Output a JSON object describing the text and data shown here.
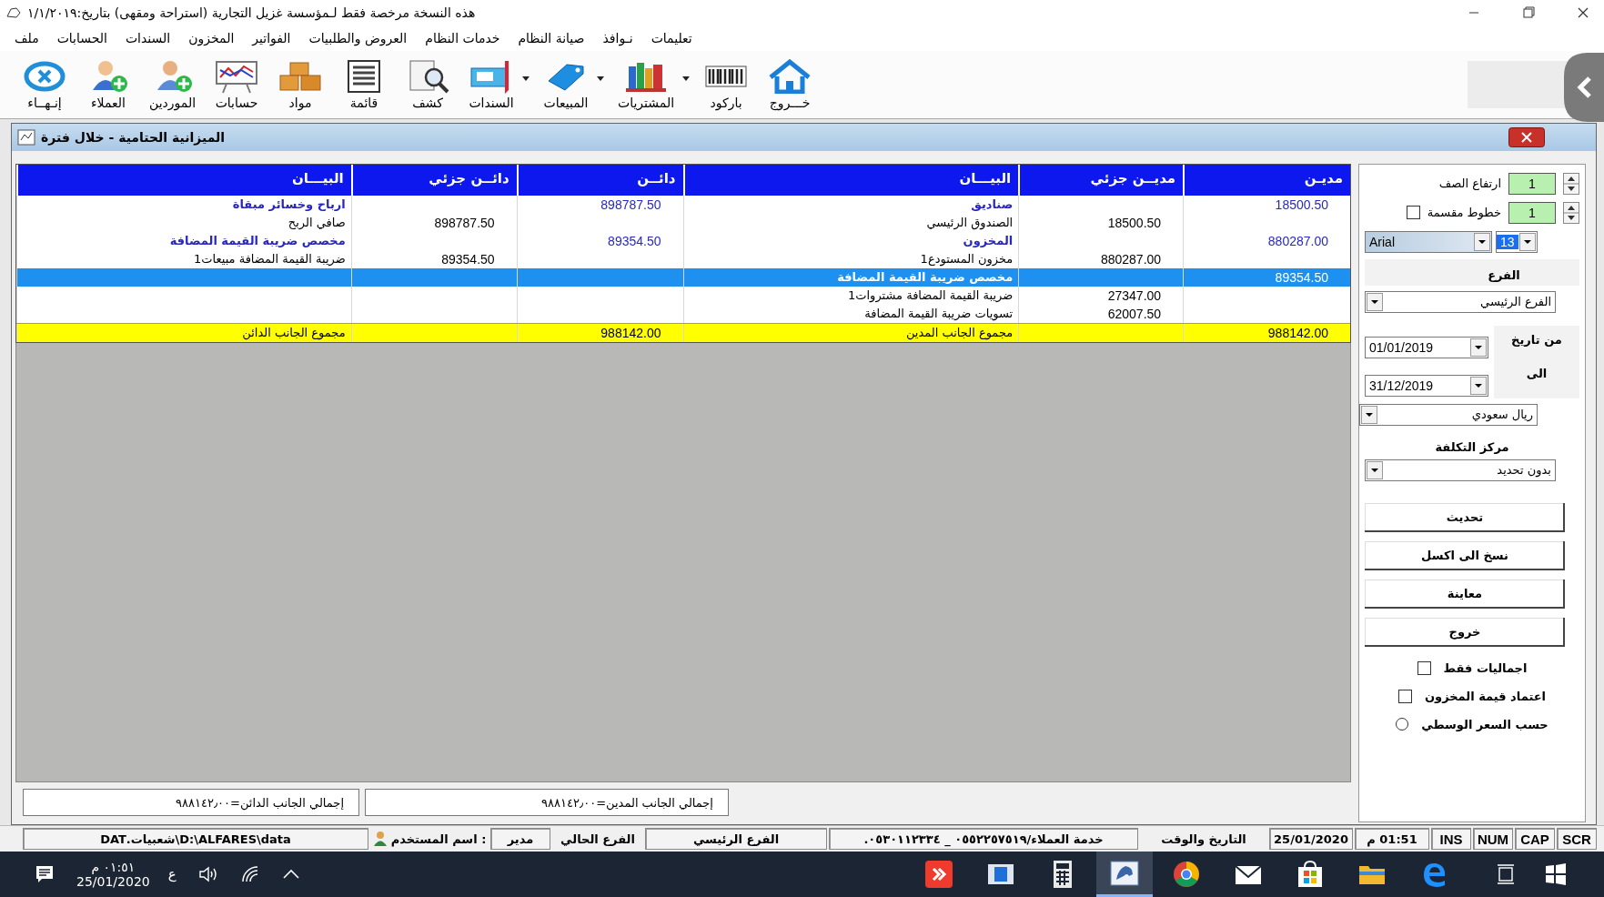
{
  "window": {
    "title": "هذه النسخة مرخصة فقط لـمؤسسة غزيل التجارية (استراحة ومقهى)  بتاريخ:١/١/٢٠١٩"
  },
  "menu": [
    "تعليمات",
    "نـوافذ",
    "صيانة النظام",
    "خدمات النظام",
    "العروض والطلبيات",
    "الفواتير",
    "المخزون",
    "السندات",
    "الحسابات",
    "ملف"
  ],
  "toolbar": [
    {
      "label": "خـــروج",
      "has_menu": false
    },
    {
      "label": "باركود",
      "has_menu": false
    },
    {
      "label": "المشتريات",
      "has_menu": true
    },
    {
      "label": "المبيعات",
      "has_menu": true
    },
    {
      "label": "السندات",
      "has_menu": true
    },
    {
      "label": "كشف",
      "has_menu": false
    },
    {
      "label": "قائمة",
      "has_menu": false
    },
    {
      "label": "مواد",
      "has_menu": false
    },
    {
      "label": "حسابات",
      "has_menu": false
    },
    {
      "label": "الموردين",
      "has_menu": false
    },
    {
      "label": "العملاء",
      "has_menu": false
    },
    {
      "label": "إنـهــاء",
      "has_menu": false
    }
  ],
  "report_window": {
    "title": "الميزانية الحتامية - خلال فترة"
  },
  "table": {
    "columns": [
      {
        "label": "مديـن",
        "kind": "amount"
      },
      {
        "label": "مديــن جزئي",
        "kind": "amount"
      },
      {
        "label": "البيـــان",
        "kind": "text"
      },
      {
        "label": "دائــن",
        "kind": "amount"
      },
      {
        "label": "دائــن جزئي",
        "kind": "amount"
      },
      {
        "label": "البيـــان",
        "kind": "text"
      }
    ],
    "rows": [
      {
        "kind": "group",
        "selected": false,
        "cells": [
          "18500.50",
          null,
          "صناديق",
          "898787.50",
          null,
          "ارباح وخسائر مبقاة"
        ]
      },
      {
        "kind": "detail",
        "selected": false,
        "cells": [
          null,
          "18500.50",
          "الصندوق الرئيسي",
          null,
          "898787.50",
          "صافي الربح"
        ]
      },
      {
        "kind": "group",
        "selected": false,
        "cells": [
          "880287.00",
          null,
          "المخزون",
          "89354.50",
          null,
          "مخصص ضريبة القيمة المضافة"
        ]
      },
      {
        "kind": "detail",
        "selected": false,
        "cells": [
          null,
          "880287.00",
          "مخزون المستودع1",
          null,
          "89354.50",
          "ضريبة القيمة المضافة مبيعات1"
        ]
      },
      {
        "kind": "group",
        "selected": true,
        "cells": [
          "89354.50",
          null,
          "مخصص ضريبة القيمة المضافة",
          null,
          null,
          null
        ]
      },
      {
        "kind": "detail",
        "selected": false,
        "cells": [
          null,
          "27347.00",
          "ضريبة القيمة المضافة مشتروات1",
          null,
          null,
          null
        ]
      },
      {
        "kind": "detail",
        "selected": false,
        "cells": [
          null,
          "62007.50",
          "تسويات ضريبة القيمة المضافة",
          null,
          null,
          null
        ]
      },
      {
        "kind": "total",
        "selected": false,
        "cells": [
          "988142.00",
          null,
          "مجموع الجانب المدين",
          "988142.00",
          null,
          "مجموع الجانب الدائن"
        ]
      }
    ]
  },
  "totals": [
    "إجمالي الجانب المدين=٩٨٨١٤٢٫٠٠",
    "إجمالي الجانب الدائن=٩٨٨١٤٢٫٠٠"
  ],
  "options_panel": {
    "row_height": {
      "label": "ارتفاع الصف",
      "value": "1"
    },
    "split_lines": {
      "label": "خطوط مقسمة",
      "checked": false,
      "value": "1"
    },
    "font": {
      "name": "Arial",
      "size": "13"
    },
    "branch": {
      "label": "الفرع",
      "value": "الفرع الرئيسي"
    },
    "from_date": {
      "label": "من تاريخ",
      "value": "01/01/2019"
    },
    "to_date": {
      "label": "الى",
      "value": "31/12/2019"
    },
    "currency": {
      "value": "ريال سعودي"
    },
    "cost_center": {
      "label": "مركز التكلفة",
      "value": "بدون تحديد"
    },
    "buttons": [
      "تحديث",
      "نسخ الى اكسل",
      "معاينة",
      "خروج"
    ],
    "options": [
      {
        "kind": "checkbox",
        "label": "اجماليات فقط",
        "checked": false
      },
      {
        "kind": "checkbox",
        "label": "اعتماد قيمة المخزون",
        "checked": false
      },
      {
        "kind": "radio",
        "label": "حسب السعر الوسطي",
        "selected": false
      }
    ]
  },
  "status_bar": [
    {
      "kind": "key",
      "text": "SCR"
    },
    {
      "kind": "key",
      "text": "CAP"
    },
    {
      "kind": "key",
      "text": "NUM"
    },
    {
      "kind": "key",
      "text": "INS"
    },
    {
      "kind": "field",
      "text": "01:51 م"
    },
    {
      "kind": "field",
      "text": "25/01/2020"
    },
    {
      "kind": "label",
      "text": "التاريخ والوقت"
    },
    {
      "kind": "field",
      "text": "خدمة العملاء/٠٥٥٢٢٥٧٥١٩ _ ٠٥٣٠١١٢٣٣٤."
    },
    {
      "kind": "field",
      "text": "الفرع الرئيسي"
    },
    {
      "kind": "label",
      "text": "الفرع الحالي"
    },
    {
      "kind": "field",
      "text": "مدير"
    },
    {
      "kind": "user-label",
      "text": ": اسم المستخدم"
    },
    {
      "kind": "field",
      "text": "D:\\ALFARES\\data\\شعبيات.DAT"
    }
  ],
  "taskbar": {
    "clock_time": "٠١:٥١ م",
    "clock_date": "25/01/2020",
    "language": "ع",
    "apps": [
      {
        "selected": false
      },
      {
        "selected": false
      },
      {
        "selected": false
      },
      {
        "selected": true
      },
      {
        "selected": false
      },
      {
        "selected": false
      },
      {
        "selected": false
      },
      {
        "selected": false
      },
      {
        "selected": false
      }
    ]
  }
}
